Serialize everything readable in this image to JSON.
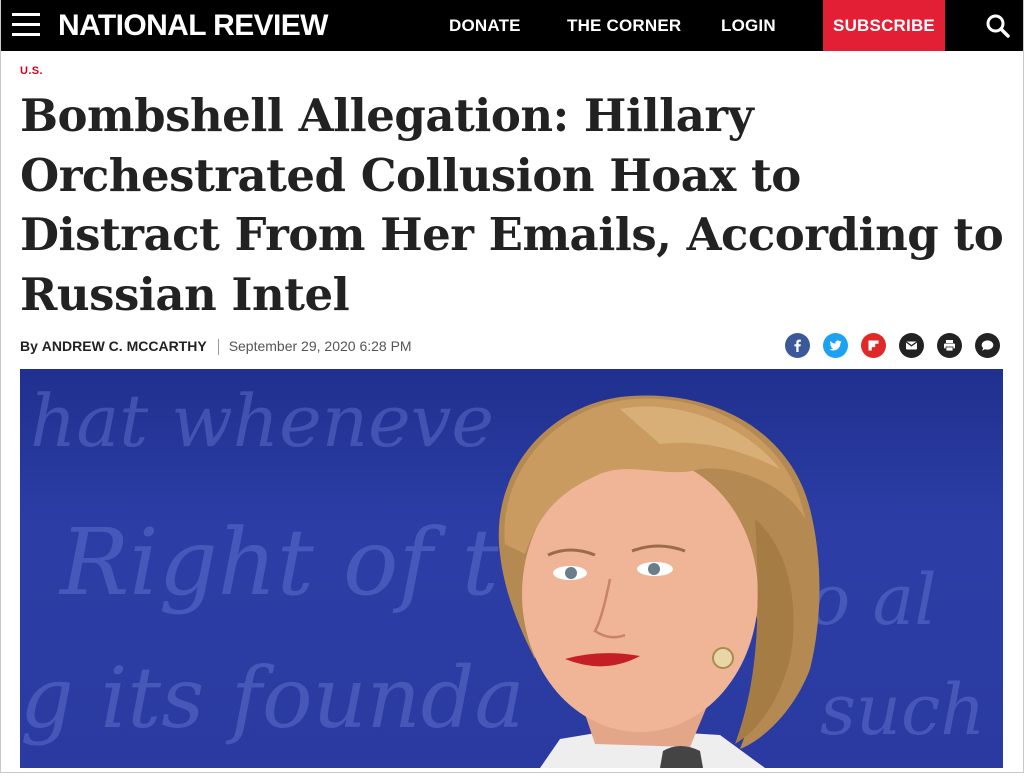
{
  "nav": {
    "logo": "NATIONAL REVIEW",
    "links": {
      "donate": "DONATE",
      "corner": "THE CORNER",
      "login": "LOGIN"
    },
    "subscribe": "SUBSCRIBE",
    "icons": {
      "menu": "hamburger-menu-icon",
      "search": "search-icon"
    }
  },
  "article": {
    "section": "U.S.",
    "headline": "Bombshell Allegation: Hillary Orchestrated Collusion Hoax to Distract From Her Emails, According to Russian Intel",
    "byline_prefix": "By",
    "author": "ANDREW C. MCCARTHY",
    "date": "September 29, 2020 6:28 PM"
  },
  "share": [
    {
      "name": "facebook-icon",
      "color": "#3b5998"
    },
    {
      "name": "twitter-icon",
      "color": "#1da1f2"
    },
    {
      "name": "flipboard-icon",
      "color": "#e12828"
    },
    {
      "name": "email-icon",
      "color": "#222222"
    },
    {
      "name": "print-icon",
      "color": "#222222"
    },
    {
      "name": "comment-icon",
      "color": "#222222"
    }
  ],
  "colors": {
    "brand_red": "#e21f35",
    "section_red": "#d0021b",
    "nav_bg": "#000000",
    "hero_bg": "#2a3aa0"
  }
}
